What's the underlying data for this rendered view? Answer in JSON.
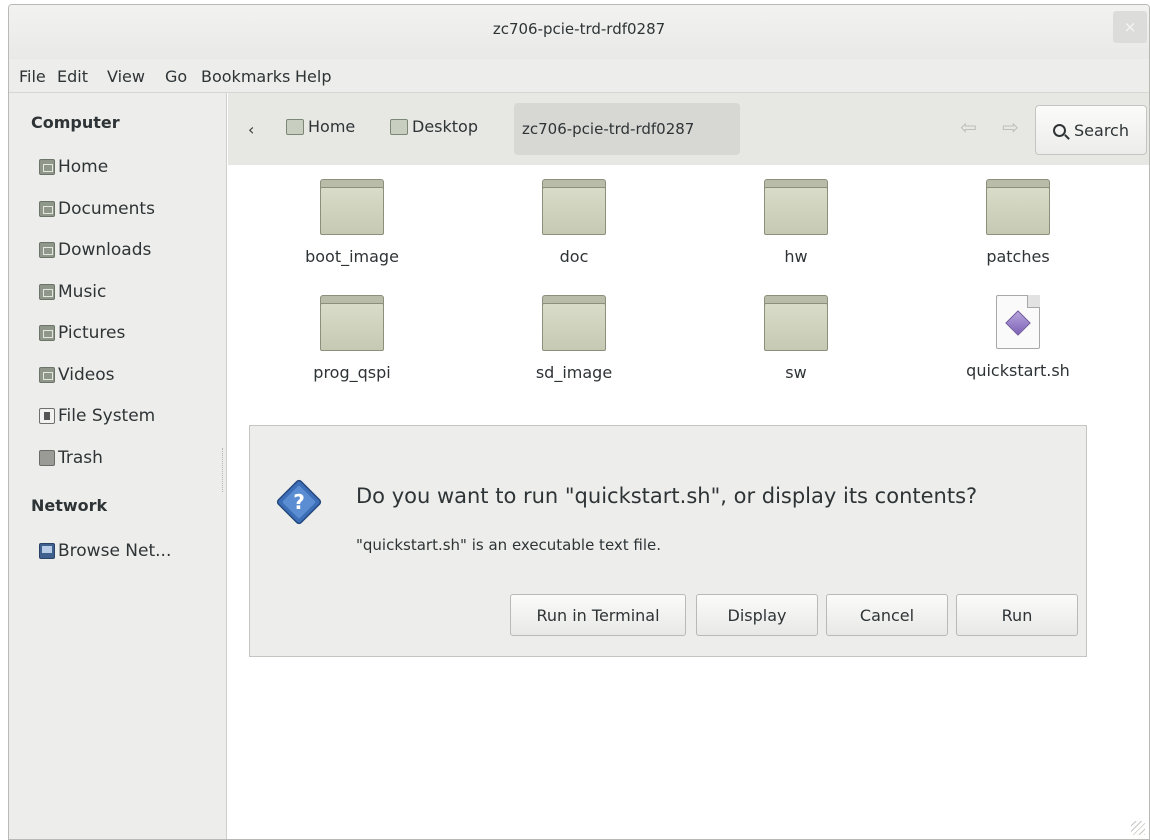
{
  "window": {
    "title": "zc706-pcie-trd-rdf0287",
    "close_label": "×"
  },
  "menubar": [
    "File",
    "Edit",
    "View",
    "Go",
    "Bookmarks",
    "Help"
  ],
  "sidebar": {
    "computer_heading": "Computer",
    "computer_items": [
      {
        "label": "Home",
        "icon": "home-folder-icon"
      },
      {
        "label": "Documents",
        "icon": "documents-folder-icon"
      },
      {
        "label": "Downloads",
        "icon": "downloads-folder-icon"
      },
      {
        "label": "Music",
        "icon": "music-folder-icon"
      },
      {
        "label": "Pictures",
        "icon": "pictures-folder-icon"
      },
      {
        "label": "Videos",
        "icon": "videos-folder-icon"
      },
      {
        "label": "File System",
        "icon": "drive-icon"
      },
      {
        "label": "Trash",
        "icon": "trash-icon"
      }
    ],
    "network_heading": "Network",
    "network_items": [
      {
        "label": "Browse Net...",
        "icon": "network-icon"
      }
    ]
  },
  "pathbar": {
    "back_glyph": "‹",
    "crumbs": [
      "Home",
      "Desktop"
    ],
    "current": "zc706-pcie-trd-rdf0287",
    "search_label": "Search"
  },
  "files": [
    {
      "name": "boot_image",
      "type": "folder"
    },
    {
      "name": "doc",
      "type": "folder"
    },
    {
      "name": "hw",
      "type": "folder"
    },
    {
      "name": "patches",
      "type": "folder"
    },
    {
      "name": "prog_qspi",
      "type": "folder"
    },
    {
      "name": "sd_image",
      "type": "folder"
    },
    {
      "name": "sw",
      "type": "folder"
    },
    {
      "name": "quickstart.sh",
      "type": "script"
    }
  ],
  "dialog": {
    "title": "Do you want to run \"quickstart.sh\", or display its contents?",
    "subtitle": "\"quickstart.sh\" is an executable text file.",
    "buttons": [
      "Run in Terminal",
      "Display",
      "Cancel",
      "Run"
    ]
  },
  "colors": {
    "accent": "#3d6fb8",
    "window_bg": "#ededeb"
  }
}
